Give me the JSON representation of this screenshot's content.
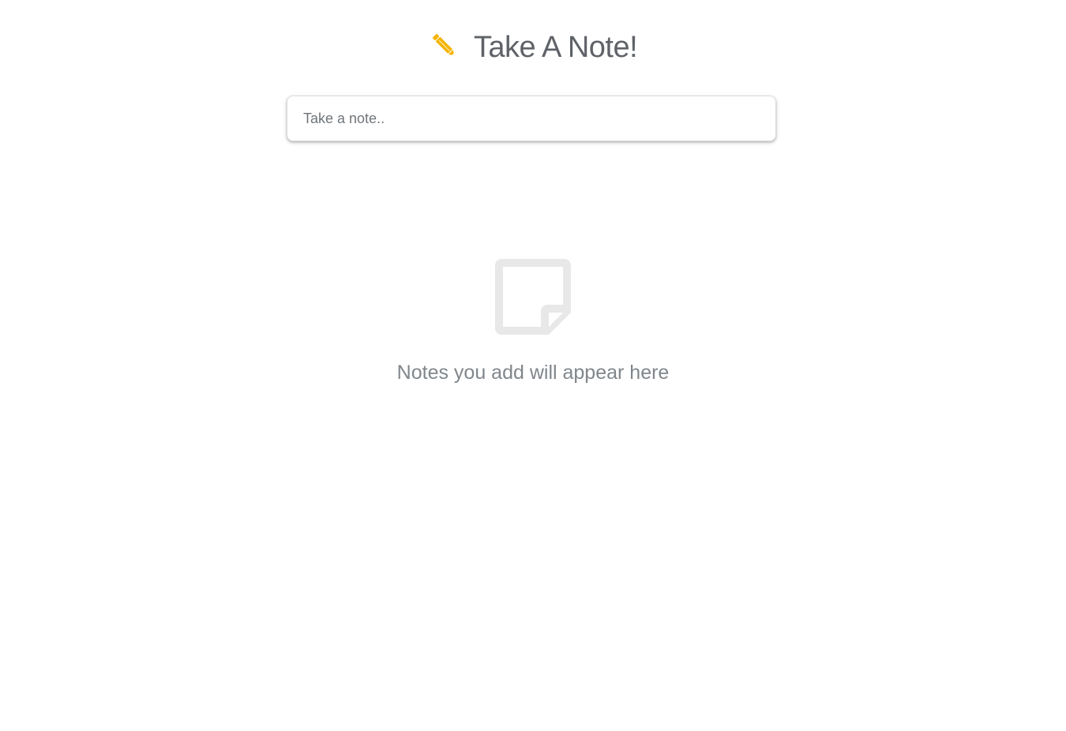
{
  "header": {
    "title": "Take A Note!",
    "icon": "pencil-icon",
    "icon_color": "#f4b400"
  },
  "note_input": {
    "placeholder": "Take a note..",
    "value": ""
  },
  "empty_state": {
    "icon": "sticky-note-icon",
    "icon_color": "#e8e8e8",
    "message": "Notes you add will appear here"
  }
}
